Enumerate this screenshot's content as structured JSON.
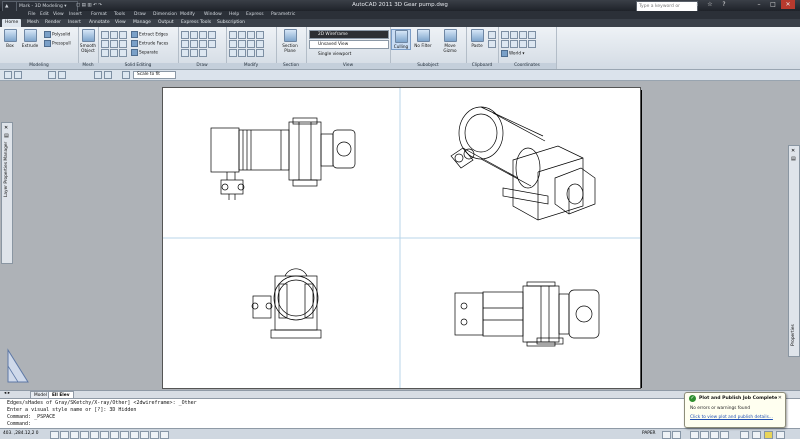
{
  "titlebar": {
    "workspace": "Mark - 3D Modeling",
    "title": "AutoCAD 2011   3D Gear pump.dwg",
    "search_placeholder": "Type a keyword or phrase"
  },
  "menu": [
    "File",
    "Edit",
    "View",
    "Insert",
    "Format",
    "Tools",
    "Draw",
    "Dimension",
    "Modify",
    "Window",
    "Help",
    "Express",
    "Parametric"
  ],
  "ribbon_tabs": [
    "Home",
    "Mesh",
    "Render",
    "Insert",
    "Annotate",
    "View",
    "Manage",
    "Output",
    "Express Tools",
    "Subscription"
  ],
  "ribbon": {
    "modeling": {
      "title": "Modeling",
      "box": "Box",
      "extrude": "Extrude",
      "polysolid": "Polysolid",
      "presspull": "Presspull"
    },
    "mesh": {
      "title": "Mesh",
      "smooth_object": "Smooth Object"
    },
    "solid_editing": {
      "title": "Solid Editing",
      "extract_edges": "Extract Edges",
      "extrude_faces": "Extrude Faces",
      "separate": "Separate"
    },
    "draw": {
      "title": "Draw"
    },
    "modify": {
      "title": "Modify"
    },
    "section": {
      "title": "Section",
      "section_plane": "Section Plane"
    },
    "view": {
      "title": "View",
      "visual_style": "2D Wireframe",
      "saved_view": "Unsaved View",
      "viewport": "Single viewport"
    },
    "subobject": {
      "title": "Subobject",
      "culling": "Culling",
      "no_filter": "No Filter",
      "move_gizmo": "Move Gizmo"
    },
    "clipboard": {
      "title": "Clipboard",
      "paste": "Paste"
    },
    "coordinates": {
      "title": "Coordinates",
      "world": "World"
    }
  },
  "toolbar": {
    "scale": "Scale to fit"
  },
  "palettes": {
    "left": "Layer Properties Manager",
    "right": "Properties"
  },
  "layout_tabs": [
    "Model",
    "Ell Elev"
  ],
  "command_lines": [
    "Edges/sHades of Gray/SKetchy/X-ray/Other] <2dwireframe>: _Other",
    "Enter a visual style name or [?]: 3D Hidden",
    "Command:  _PSPACE",
    "Command:"
  ],
  "status": {
    "coords": "403.  ,284.12,2  0",
    "paper": "PAPER"
  },
  "balloon": {
    "title": "Plot and Publish Job Complete",
    "message": "No errors or warnings found",
    "link": "Click to view plot and publish details..."
  }
}
